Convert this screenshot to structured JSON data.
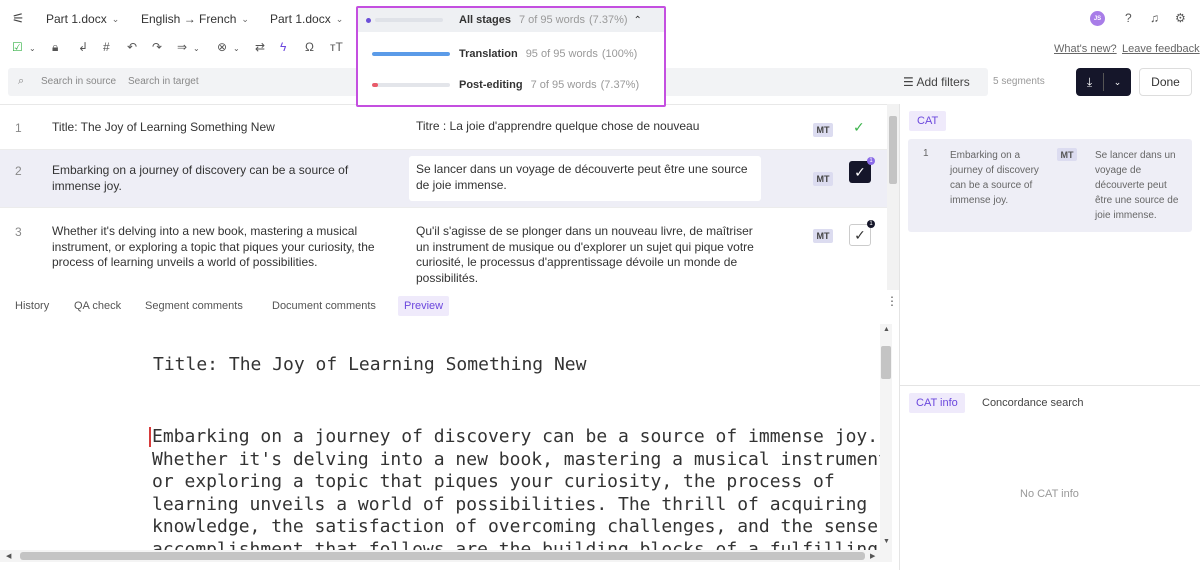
{
  "header": {
    "file1": "Part 1.docx",
    "language_pair": "English → French",
    "file2": "Part 1.docx",
    "avatar_initials": "JS"
  },
  "stages": {
    "label": "All stages",
    "count": "7 of 95 words",
    "percent": "(7.37%)",
    "progress_fraction": 0.0737,
    "items": [
      {
        "name": "Translation",
        "count": "95 of 95 words",
        "percent": "(100%)",
        "progress_fraction": 1.0,
        "color": "#5b9be8"
      },
      {
        "name": "Post-editing",
        "count": "7 of 95 words",
        "percent": "(7.37%)",
        "progress_fraction": 0.0737,
        "color": "#e85b6a"
      }
    ]
  },
  "links": {
    "whats_new": "What's new?",
    "leave_feedback": "Leave feedback"
  },
  "search": {
    "source_placeholder": "Search in source",
    "target_placeholder": "Search in target",
    "add_filters": "Add filters",
    "segments_count": "5 segments",
    "done": "Done"
  },
  "segments": [
    {
      "num": "1",
      "source": "Title: The Joy of Learning Something New",
      "target": "Titre : La joie d'apprendre quelque chose de nouveau",
      "mt": "MT",
      "status": "confirmed"
    },
    {
      "num": "2",
      "source": "Embarking on a journey of discovery can be a source of immense joy.",
      "target": "Se lancer dans un voyage de découverte peut être une source de joie immense.",
      "mt": "MT",
      "status": "selected",
      "badge": "1"
    },
    {
      "num": "3",
      "source": "Whether it's delving into a new book, mastering a musical instrument, or exploring a topic that piques your curiosity, the process of learning unveils a world of possibilities.",
      "target": "Qu'il s'agisse de se plonger dans un nouveau livre, de maîtriser un instrument de musique ou d'explorer un sujet qui pique votre curiosité, le processus d'apprentissage dévoile un monde de possibilités.",
      "mt": "MT",
      "status": "unconfirmed",
      "badge": "1"
    }
  ],
  "bottom_tabs": [
    "History",
    "QA check",
    "Segment comments",
    "Document comments",
    "Preview"
  ],
  "preview": {
    "title": "Title: The Joy of Learning Something New",
    "lines": [
      "Embarking on a journey of discovery can be a source of immense joy.",
      "Whether it's delving into a new book, mastering a musical instrument",
      "or exploring a topic that piques your curiosity, the process of",
      "learning unveils a world of possibilities. The thrill of acquiring",
      "knowledge, the satisfaction of overcoming challenges, and the sense",
      "accomplishment that follows are the building blocks of a fulfilling"
    ]
  },
  "cat": {
    "tag": "CAT",
    "num": "1",
    "source": "Embarking on a journey of discovery can be a source of immense joy.",
    "mt": "MT",
    "target": "Se lancer dans un voyage de découverte peut être une source de joie immense.",
    "info_tab": "CAT info",
    "concordance_tab": "Concordance search",
    "no_info": "No CAT info"
  },
  "colors": {
    "accent": "#6b47dd",
    "highlight_border": "#c44fe0",
    "dark_button": "#15162a"
  }
}
